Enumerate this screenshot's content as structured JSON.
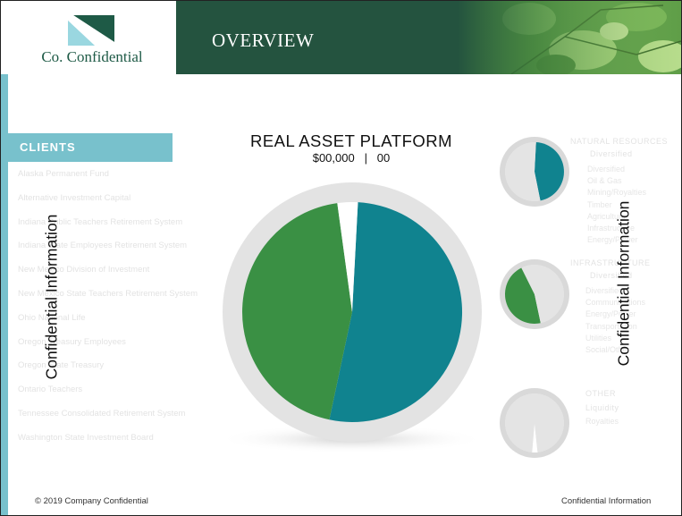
{
  "brand": {
    "name": "Co. Confidential",
    "primary_color": "#24533f",
    "accent_color": "#78c1cc"
  },
  "header": {
    "title": "OVERVIEW"
  },
  "sidebar": {
    "heading": "CLIENTS",
    "clients": [
      "Alaska Permanent Fund",
      "Alternative Investment Capital",
      "Indiana Public Teachers Retirement System",
      "Indiana State Employees Retirement System",
      "New Mexico Division of Investment",
      "New Mexico State Teachers Retirement System",
      "Ohio National Life",
      "Oregon Treasury Employees",
      "Oregon State Treasury",
      "Ontario Teachers",
      "Tennessee Consolidated Retirement System",
      "Washington State Investment Board"
    ]
  },
  "watermark": {
    "text": "Confidential Information"
  },
  "platform": {
    "title": "REAL ASSET PLATFORM",
    "amount": "$00,000",
    "separator": "|",
    "count": "00"
  },
  "chart_data": [
    {
      "type": "pie",
      "title": "REAL ASSET PLATFORM",
      "slices": [
        {
          "value": 52.5,
          "color": "#10838f"
        },
        {
          "value": 44.5,
          "color": "#3a9044"
        },
        {
          "value": 3.0,
          "color": "#ffffff"
        }
      ]
    },
    {
      "type": "pie",
      "slices": [
        {
          "value": 46,
          "color": "#10838f"
        },
        {
          "value": 54,
          "color": "#e4e4e4"
        }
      ]
    },
    {
      "type": "pie",
      "slices": [
        {
          "value": 46,
          "color": "#3a9044"
        },
        {
          "value": 54,
          "color": "#e4e4e4"
        }
      ]
    },
    {
      "type": "pie",
      "slices": [
        {
          "value": 3,
          "color": "#ffffff"
        },
        {
          "value": 97,
          "color": "#e4e4e4"
        }
      ]
    }
  ],
  "right_panel": {
    "group1": {
      "heading": "NATURAL RESOURCES",
      "subheading": "Diversified",
      "items": [
        "Diversified",
        "Oil & Gas",
        "Mining/Royalties",
        "Timber",
        "Agriculture",
        "Infrastructure",
        "Energy/Power"
      ]
    },
    "group2": {
      "heading": "INFRASTRUCTURE",
      "subheading": "Diversified",
      "items": [
        "Diversified",
        "Communications",
        "Energy/Power",
        "Transportation",
        "Utilities",
        "Social/Other"
      ]
    },
    "group3": {
      "heading": "OTHER",
      "subheading": "Liquidity",
      "items": [
        "Royalties"
      ]
    }
  },
  "footer": {
    "copyright": "© 2019  Company Confidential",
    "right": "Confidential Information"
  }
}
